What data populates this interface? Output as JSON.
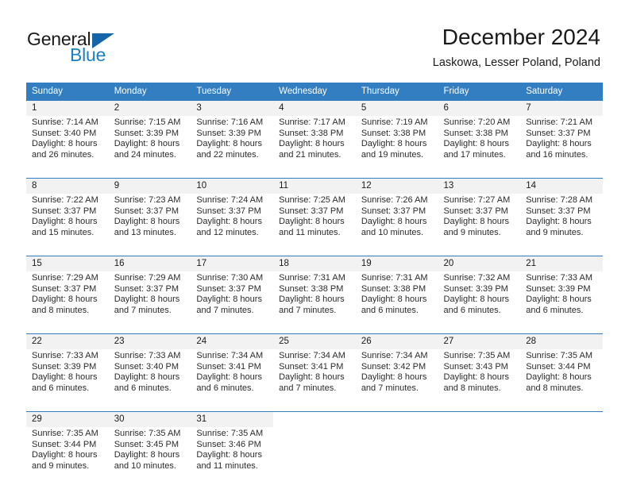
{
  "brand": {
    "name_part1": "General",
    "name_part2": "Blue",
    "logo_icon": "triangle-flag-icon",
    "accent_color": "#1c7fc4",
    "dark_color": "#1565a8"
  },
  "header": {
    "title": "December 2024",
    "location": "Laskowa, Lesser Poland, Poland"
  },
  "theme": {
    "header_row_bg": "#337ec0",
    "header_row_text": "#ffffff",
    "daynum_bg": "#f2f2f2",
    "cell_bg": "#ffffff",
    "row_border": "#337ec0",
    "text": "#1a1a1a"
  },
  "calendar": {
    "weekday_headers": [
      "Sunday",
      "Monday",
      "Tuesday",
      "Wednesday",
      "Thursday",
      "Friday",
      "Saturday"
    ],
    "weeks": [
      {
        "days": [
          {
            "date": "1",
            "sunrise": "Sunrise: 7:14 AM",
            "sunset": "Sunset: 3:40 PM",
            "daylight_line1": "Daylight: 8 hours",
            "daylight_line2": "and 26 minutes."
          },
          {
            "date": "2",
            "sunrise": "Sunrise: 7:15 AM",
            "sunset": "Sunset: 3:39 PM",
            "daylight_line1": "Daylight: 8 hours",
            "daylight_line2": "and 24 minutes."
          },
          {
            "date": "3",
            "sunrise": "Sunrise: 7:16 AM",
            "sunset": "Sunset: 3:39 PM",
            "daylight_line1": "Daylight: 8 hours",
            "daylight_line2": "and 22 minutes."
          },
          {
            "date": "4",
            "sunrise": "Sunrise: 7:17 AM",
            "sunset": "Sunset: 3:38 PM",
            "daylight_line1": "Daylight: 8 hours",
            "daylight_line2": "and 21 minutes."
          },
          {
            "date": "5",
            "sunrise": "Sunrise: 7:19 AM",
            "sunset": "Sunset: 3:38 PM",
            "daylight_line1": "Daylight: 8 hours",
            "daylight_line2": "and 19 minutes."
          },
          {
            "date": "6",
            "sunrise": "Sunrise: 7:20 AM",
            "sunset": "Sunset: 3:38 PM",
            "daylight_line1": "Daylight: 8 hours",
            "daylight_line2": "and 17 minutes."
          },
          {
            "date": "7",
            "sunrise": "Sunrise: 7:21 AM",
            "sunset": "Sunset: 3:37 PM",
            "daylight_line1": "Daylight: 8 hours",
            "daylight_line2": "and 16 minutes."
          }
        ]
      },
      {
        "days": [
          {
            "date": "8",
            "sunrise": "Sunrise: 7:22 AM",
            "sunset": "Sunset: 3:37 PM",
            "daylight_line1": "Daylight: 8 hours",
            "daylight_line2": "and 15 minutes."
          },
          {
            "date": "9",
            "sunrise": "Sunrise: 7:23 AM",
            "sunset": "Sunset: 3:37 PM",
            "daylight_line1": "Daylight: 8 hours",
            "daylight_line2": "and 13 minutes."
          },
          {
            "date": "10",
            "sunrise": "Sunrise: 7:24 AM",
            "sunset": "Sunset: 3:37 PM",
            "daylight_line1": "Daylight: 8 hours",
            "daylight_line2": "and 12 minutes."
          },
          {
            "date": "11",
            "sunrise": "Sunrise: 7:25 AM",
            "sunset": "Sunset: 3:37 PM",
            "daylight_line1": "Daylight: 8 hours",
            "daylight_line2": "and 11 minutes."
          },
          {
            "date": "12",
            "sunrise": "Sunrise: 7:26 AM",
            "sunset": "Sunset: 3:37 PM",
            "daylight_line1": "Daylight: 8 hours",
            "daylight_line2": "and 10 minutes."
          },
          {
            "date": "13",
            "sunrise": "Sunrise: 7:27 AM",
            "sunset": "Sunset: 3:37 PM",
            "daylight_line1": "Daylight: 8 hours",
            "daylight_line2": "and 9 minutes."
          },
          {
            "date": "14",
            "sunrise": "Sunrise: 7:28 AM",
            "sunset": "Sunset: 3:37 PM",
            "daylight_line1": "Daylight: 8 hours",
            "daylight_line2": "and 9 minutes."
          }
        ]
      },
      {
        "days": [
          {
            "date": "15",
            "sunrise": "Sunrise: 7:29 AM",
            "sunset": "Sunset: 3:37 PM",
            "daylight_line1": "Daylight: 8 hours",
            "daylight_line2": "and 8 minutes."
          },
          {
            "date": "16",
            "sunrise": "Sunrise: 7:29 AM",
            "sunset": "Sunset: 3:37 PM",
            "daylight_line1": "Daylight: 8 hours",
            "daylight_line2": "and 7 minutes."
          },
          {
            "date": "17",
            "sunrise": "Sunrise: 7:30 AM",
            "sunset": "Sunset: 3:37 PM",
            "daylight_line1": "Daylight: 8 hours",
            "daylight_line2": "and 7 minutes."
          },
          {
            "date": "18",
            "sunrise": "Sunrise: 7:31 AM",
            "sunset": "Sunset: 3:38 PM",
            "daylight_line1": "Daylight: 8 hours",
            "daylight_line2": "and 7 minutes."
          },
          {
            "date": "19",
            "sunrise": "Sunrise: 7:31 AM",
            "sunset": "Sunset: 3:38 PM",
            "daylight_line1": "Daylight: 8 hours",
            "daylight_line2": "and 6 minutes."
          },
          {
            "date": "20",
            "sunrise": "Sunrise: 7:32 AM",
            "sunset": "Sunset: 3:39 PM",
            "daylight_line1": "Daylight: 8 hours",
            "daylight_line2": "and 6 minutes."
          },
          {
            "date": "21",
            "sunrise": "Sunrise: 7:33 AM",
            "sunset": "Sunset: 3:39 PM",
            "daylight_line1": "Daylight: 8 hours",
            "daylight_line2": "and 6 minutes."
          }
        ]
      },
      {
        "days": [
          {
            "date": "22",
            "sunrise": "Sunrise: 7:33 AM",
            "sunset": "Sunset: 3:39 PM",
            "daylight_line1": "Daylight: 8 hours",
            "daylight_line2": "and 6 minutes."
          },
          {
            "date": "23",
            "sunrise": "Sunrise: 7:33 AM",
            "sunset": "Sunset: 3:40 PM",
            "daylight_line1": "Daylight: 8 hours",
            "daylight_line2": "and 6 minutes."
          },
          {
            "date": "24",
            "sunrise": "Sunrise: 7:34 AM",
            "sunset": "Sunset: 3:41 PM",
            "daylight_line1": "Daylight: 8 hours",
            "daylight_line2": "and 6 minutes."
          },
          {
            "date": "25",
            "sunrise": "Sunrise: 7:34 AM",
            "sunset": "Sunset: 3:41 PM",
            "daylight_line1": "Daylight: 8 hours",
            "daylight_line2": "and 7 minutes."
          },
          {
            "date": "26",
            "sunrise": "Sunrise: 7:34 AM",
            "sunset": "Sunset: 3:42 PM",
            "daylight_line1": "Daylight: 8 hours",
            "daylight_line2": "and 7 minutes."
          },
          {
            "date": "27",
            "sunrise": "Sunrise: 7:35 AM",
            "sunset": "Sunset: 3:43 PM",
            "daylight_line1": "Daylight: 8 hours",
            "daylight_line2": "and 8 minutes."
          },
          {
            "date": "28",
            "sunrise": "Sunrise: 7:35 AM",
            "sunset": "Sunset: 3:44 PM",
            "daylight_line1": "Daylight: 8 hours",
            "daylight_line2": "and 8 minutes."
          }
        ]
      },
      {
        "days": [
          {
            "date": "29",
            "sunrise": "Sunrise: 7:35 AM",
            "sunset": "Sunset: 3:44 PM",
            "daylight_line1": "Daylight: 8 hours",
            "daylight_line2": "and 9 minutes."
          },
          {
            "date": "30",
            "sunrise": "Sunrise: 7:35 AM",
            "sunset": "Sunset: 3:45 PM",
            "daylight_line1": "Daylight: 8 hours",
            "daylight_line2": "and 10 minutes."
          },
          {
            "date": "31",
            "sunrise": "Sunrise: 7:35 AM",
            "sunset": "Sunset: 3:46 PM",
            "daylight_line1": "Daylight: 8 hours",
            "daylight_line2": "and 11 minutes."
          },
          {
            "date": "",
            "sunrise": "",
            "sunset": "",
            "daylight_line1": "",
            "daylight_line2": ""
          },
          {
            "date": "",
            "sunrise": "",
            "sunset": "",
            "daylight_line1": "",
            "daylight_line2": ""
          },
          {
            "date": "",
            "sunrise": "",
            "sunset": "",
            "daylight_line1": "",
            "daylight_line2": ""
          },
          {
            "date": "",
            "sunrise": "",
            "sunset": "",
            "daylight_line1": "",
            "daylight_line2": ""
          }
        ]
      }
    ]
  }
}
